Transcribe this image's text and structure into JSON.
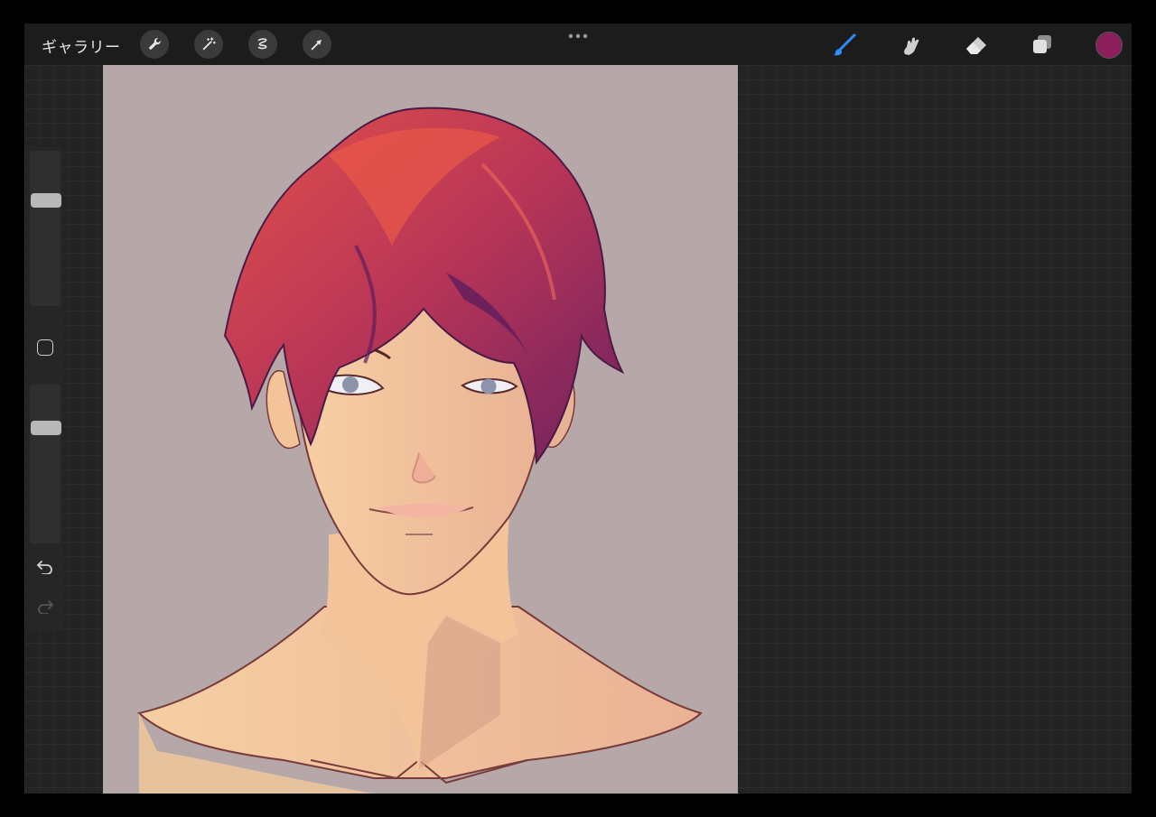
{
  "topbar": {
    "gallery_label": "ギャラリー",
    "left_tools": [
      "actions-wrench-icon",
      "adjustments-wand-icon",
      "selection-icon",
      "transform-arrow-icon"
    ],
    "right_tools": [
      "brush-icon",
      "smudge-icon",
      "eraser-icon",
      "layers-icon"
    ],
    "active_tool": "brush-icon",
    "accent_color": "#2f8cff",
    "current_color": "#8a1f5c"
  },
  "sidebar": {
    "brush_size": 0.7,
    "opacity": 0.75
  },
  "canvas": {
    "background_color": "#b6a8a8"
  }
}
